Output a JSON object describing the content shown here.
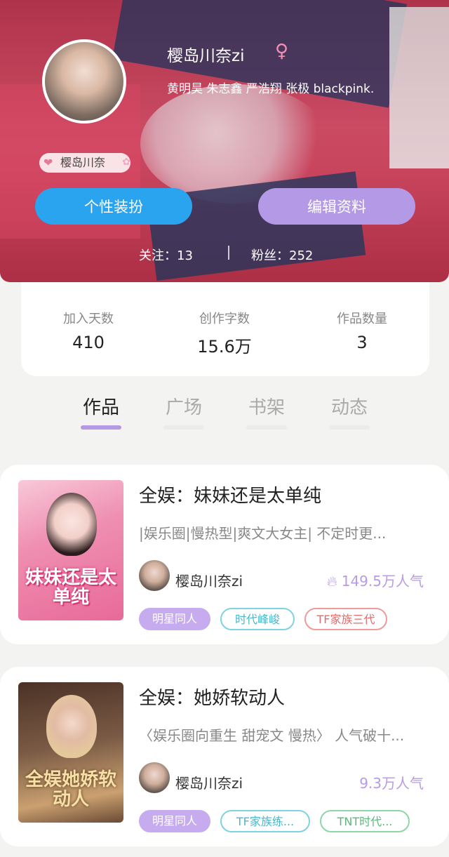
{
  "profile": {
    "username": "樱岛川奈zi",
    "gender_icon": "female-icon",
    "interests": "黄明昊 朱志鑫 严浩翔 张极 blackpink.",
    "name_badge": "樱岛川奈",
    "dress_button": "个性装扮",
    "edit_button": "编辑资料",
    "following": "关注：13",
    "followers": "粉丝：252"
  },
  "stats": [
    {
      "label": "加入天数",
      "value": "410"
    },
    {
      "label": "创作字数",
      "value": "15.6万"
    },
    {
      "label": "作品数量",
      "value": "3"
    }
  ],
  "tabs": [
    {
      "label": "作品",
      "active": true
    },
    {
      "label": "广场",
      "active": false
    },
    {
      "label": "书架",
      "active": false
    },
    {
      "label": "动态",
      "active": false
    }
  ],
  "works": [
    {
      "title": "全娱：妹妹还是太单纯",
      "description": "|娱乐圈|慢热型|爽文大女主| 不定时更...",
      "author": "樱岛川奈zi",
      "popularity": "149.5万人气",
      "popularity_icon": "fire-icon",
      "cover_text": "妹妹还是太单纯",
      "tags": [
        "明星同人",
        "时代峰峻",
        "TF家族三代"
      ]
    },
    {
      "title": "全娱：她娇软动人",
      "description": "〈娱乐圈向重生 甜宠文 慢热〉 人气破十...",
      "author": "樱岛川奈zi",
      "popularity": "9.3万人气",
      "cover_text": "全娱她娇软动人",
      "tags": [
        "明星同人",
        "TF家族练...",
        "TNT时代..."
      ]
    }
  ],
  "colors": {
    "accent_purple": "#b49ae6",
    "button_blue": "#2ba4f0",
    "background": "#f3f3f1"
  }
}
